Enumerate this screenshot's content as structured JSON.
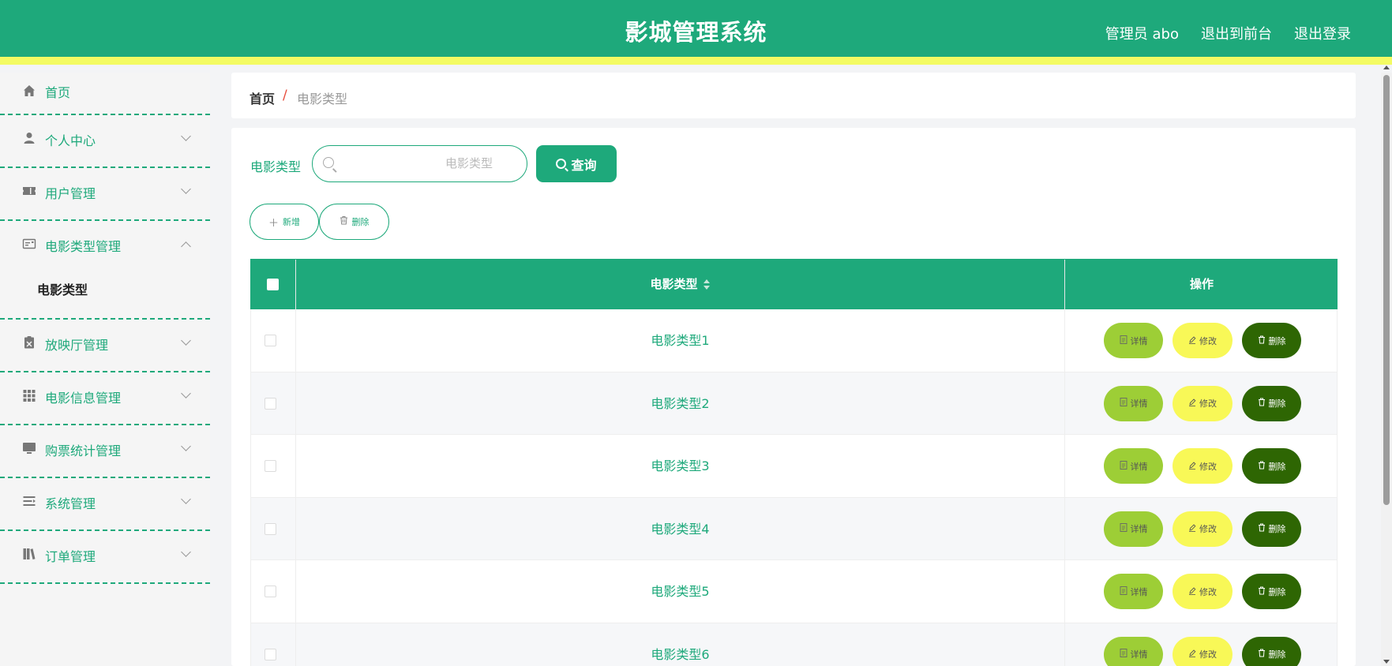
{
  "header": {
    "title": "影城管理系统",
    "links": [
      "管理员 abo",
      "退出到前台",
      "退出登录"
    ]
  },
  "sidebar": {
    "items": [
      {
        "label": "首页",
        "icon": "home-icon"
      },
      {
        "label": "个人中心",
        "icon": "user-icon"
      },
      {
        "label": "用户管理",
        "icon": "ticket-icon"
      },
      {
        "label": "电影类型管理",
        "icon": "id-card-icon",
        "expanded": true,
        "children": [
          "电影类型"
        ]
      },
      {
        "label": "放映厅管理",
        "icon": "clipboard-icon"
      },
      {
        "label": "电影信息管理",
        "icon": "grid-icon"
      },
      {
        "label": "购票统计管理",
        "icon": "monitor-icon"
      },
      {
        "label": "系统管理",
        "icon": "list-icon"
      },
      {
        "label": "订单管理",
        "icon": "book-icon"
      }
    ]
  },
  "breadcrumb": {
    "home": "首页",
    "separator": "/",
    "current": "电影类型"
  },
  "search": {
    "label": "电影类型",
    "placeholder": "电影类型",
    "value": "",
    "button": "查询"
  },
  "actions": {
    "add": "新增",
    "delete": "删除"
  },
  "table": {
    "columns": [
      "电影类型",
      "操作"
    ],
    "rows": [
      {
        "type": "电影类型1"
      },
      {
        "type": "电影类型2"
      },
      {
        "type": "电影类型3"
      },
      {
        "type": "电影类型4"
      },
      {
        "type": "电影类型5"
      },
      {
        "type": "电影类型6"
      }
    ],
    "row_actions": {
      "detail": "详情",
      "edit": "修改",
      "delete": "删除"
    }
  },
  "colors": {
    "primary": "#1ea97b",
    "stripe_yellow": "#f3fb63",
    "detail_btn": "#9dce36",
    "edit_btn": "#f8f857",
    "delete_btn": "#2e6603"
  }
}
